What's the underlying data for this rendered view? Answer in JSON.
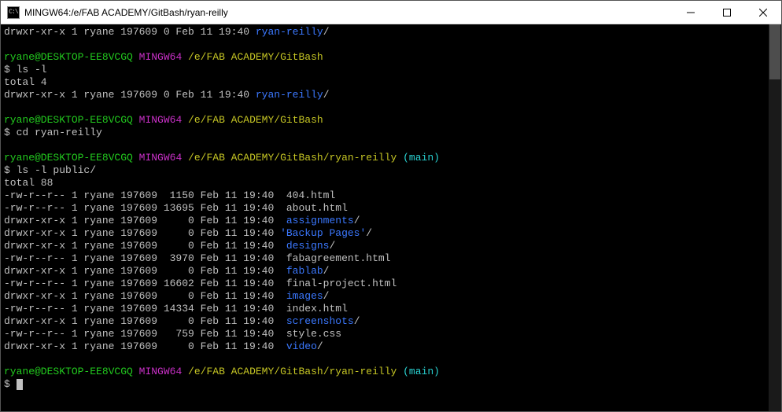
{
  "window": {
    "title": "MINGW64:/e/FAB ACADEMY/GitBash/ryan-reilly",
    "icon_text": "C:\\"
  },
  "user": "ryane@DESKTOP-EE8VCGQ",
  "env": "MINGW64",
  "branch": "(main)",
  "dollar": "$",
  "top_line": {
    "perms": "drwxr-xr-x 1 ryane 197609 0 Feb 11 19:40 ",
    "name": "ryan-reilly",
    "slash": "/"
  },
  "block1": {
    "path": "/e/FAB ACADEMY/GitBash",
    "cmd": "ls -l",
    "total": "total 4",
    "line_perms": "drwxr-xr-x 1 ryane 197609 0 Feb 11 19:40 ",
    "line_name": "ryan-reilly",
    "line_slash": "/"
  },
  "block2": {
    "path": "/e/FAB ACADEMY/GitBash",
    "cmd": "cd ryan-reilly"
  },
  "block3": {
    "path": "/e/FAB ACADEMY/GitBash/ryan-reilly",
    "cmd": "ls -l public/",
    "total": "total 88",
    "rows": [
      {
        "pre": "-rw-r--r-- 1 ryane 197609  1150 Feb 11 19:40  ",
        "name": "404.html",
        "dir": false
      },
      {
        "pre": "-rw-r--r-- 1 ryane 197609 13695 Feb 11 19:40  ",
        "name": "about.html",
        "dir": false
      },
      {
        "pre": "drwxr-xr-x 1 ryane 197609     0 Feb 11 19:40  ",
        "name": "assignments",
        "dir": true
      },
      {
        "pre": "drwxr-xr-x 1 ryane 197609     0 Feb 11 19:40 ",
        "name": "'Backup Pages'",
        "dir": true
      },
      {
        "pre": "drwxr-xr-x 1 ryane 197609     0 Feb 11 19:40  ",
        "name": "designs",
        "dir": true
      },
      {
        "pre": "-rw-r--r-- 1 ryane 197609  3970 Feb 11 19:40  ",
        "name": "fabagreement.html",
        "dir": false
      },
      {
        "pre": "drwxr-xr-x 1 ryane 197609     0 Feb 11 19:40  ",
        "name": "fablab",
        "dir": true
      },
      {
        "pre": "-rw-r--r-- 1 ryane 197609 16602 Feb 11 19:40  ",
        "name": "final-project.html",
        "dir": false
      },
      {
        "pre": "drwxr-xr-x 1 ryane 197609     0 Feb 11 19:40  ",
        "name": "images",
        "dir": true
      },
      {
        "pre": "-rw-r--r-- 1 ryane 197609 14334 Feb 11 19:40  ",
        "name": "index.html",
        "dir": false
      },
      {
        "pre": "drwxr-xr-x 1 ryane 197609     0 Feb 11 19:40  ",
        "name": "screenshots",
        "dir": true
      },
      {
        "pre": "-rw-r--r-- 1 ryane 197609   759 Feb 11 19:40  ",
        "name": "style.css",
        "dir": false
      },
      {
        "pre": "drwxr-xr-x 1 ryane 197609     0 Feb 11 19:40  ",
        "name": "video",
        "dir": true
      }
    ]
  },
  "block4": {
    "path": "/e/FAB ACADEMY/GitBash/ryan-reilly"
  }
}
